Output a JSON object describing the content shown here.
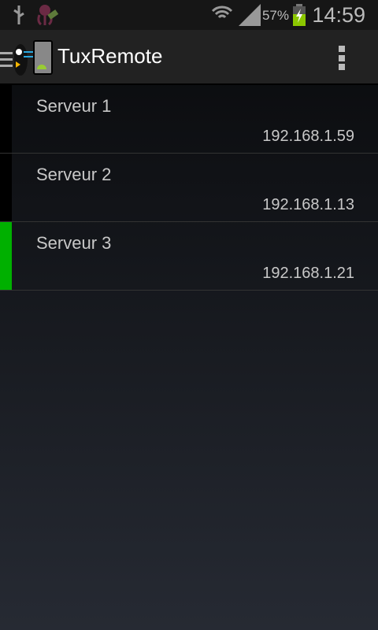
{
  "status_bar": {
    "battery_percent": "57%",
    "time": "14:59",
    "icons": [
      "usb-icon",
      "octopus-app-icon",
      "wifi-icon",
      "signal-icon",
      "battery-charging-icon"
    ],
    "battery_color": "#8cc700"
  },
  "app_bar": {
    "title": "TuxRemote",
    "icons": [
      "drawer-menu-icon",
      "app-logo-icon",
      "overflow-menu-icon"
    ]
  },
  "servers": [
    {
      "name": "Serveur 1",
      "ip": "192.168.1.59",
      "connected": false
    },
    {
      "name": "Serveur 2",
      "ip": "192.168.1.13",
      "connected": false
    },
    {
      "name": "Serveur 3",
      "ip": "192.168.1.21",
      "connected": true
    }
  ],
  "colors": {
    "connected": "#00b000",
    "disconnected": "#000000"
  }
}
